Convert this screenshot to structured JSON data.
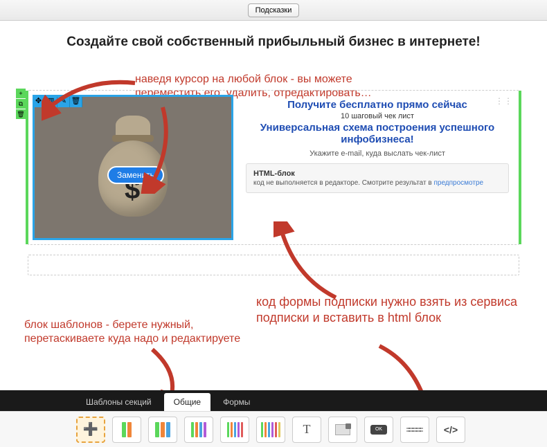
{
  "topbar": {
    "hints_label": "Подсказки"
  },
  "page": {
    "title": "Создайте свой собственный прибыльный бизнес в интернете!"
  },
  "annotations": {
    "hover": "наведя курсор на любой блок - вы можете переместить его, удалить, отредактировать…",
    "form_code": "код формы подписки нужно взять из сервиса подписки и вставить в html блок",
    "templates": "блок шаблонов - берете нужный, перетаскиваете куда надо и редактируете"
  },
  "image_block": {
    "toolbar": [
      "✥",
      "▥",
      "✎",
      "🗑"
    ],
    "replace_label": "Заменить",
    "dollar": "$"
  },
  "text_col": {
    "line1": "Получите бесплатно прямо сейчас",
    "line2": "10 шаговый чек лист",
    "line3": "Универсальная схема построения успешного инфобизнеса!",
    "hint": "Укажите e-mail, куда выслать чек-лист"
  },
  "html_block": {
    "title": "HTML-блок",
    "note_prefix": "код не выполняется в редакторе. Смотрите результат в ",
    "link": "предпросмотре"
  },
  "tabs": {
    "sections": "Шаблоны секций",
    "general": "Общие",
    "forms": "Формы"
  },
  "templates": {
    "add": "➕",
    "text": "T",
    "button_label": "OK",
    "code": "</>"
  }
}
